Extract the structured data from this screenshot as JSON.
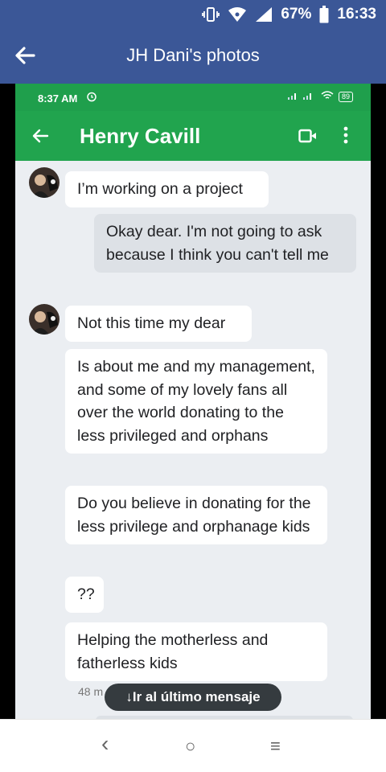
{
  "status_bar": {
    "battery": "67%",
    "time": "16:33",
    "icons": [
      "vibrate-icon",
      "wifi-icon",
      "signal-icon",
      "battery-icon"
    ]
  },
  "header": {
    "title": "JH Dani's photos",
    "back_icon": "back-arrow-icon"
  },
  "screenshot": {
    "status_bar": {
      "time": "8:37 AM",
      "battery": "89"
    },
    "app_bar": {
      "contact_name": "Henry Cavill"
    },
    "messages": [
      {
        "direction": "in",
        "text": "I’m working on a project"
      },
      {
        "direction": "out",
        "text": "Okay dear. I'm not going to ask because I think you can't tell me"
      },
      {
        "direction": "in",
        "text": "Not this time my dear"
      },
      {
        "direction": "in",
        "text": "Is about me and my management, and some of my lovely fans all over the world donating to the less privileged and orphans"
      },
      {
        "direction": "in",
        "text": "Do you believe in donating for the less privilege and orphanage kids"
      },
      {
        "direction": "in",
        "text": "??"
      },
      {
        "direction": "in",
        "text": "Helping the motherless and fatherless kids"
      }
    ],
    "timestamp_partial": "48 m",
    "jump_button_label": "↓Ir al último mensaje"
  },
  "nav_bar": {
    "back": "‹",
    "home": "○",
    "recents": "≡"
  },
  "colors": {
    "facebook_blue": "#3b5797",
    "whatsapp_green": "#21a44e",
    "chat_background": "#ebeef2"
  }
}
